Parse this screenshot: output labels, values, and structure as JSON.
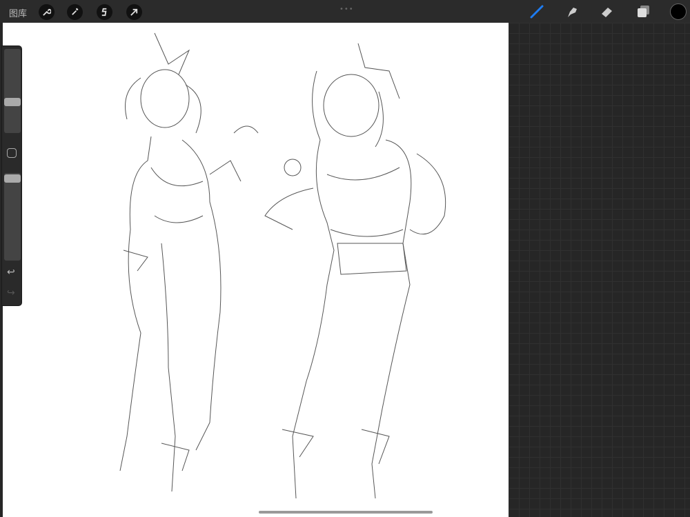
{
  "topbar": {
    "gallery_label": "图库",
    "left_tools": [
      "wrench-icon",
      "magic-wand-icon",
      "selection-icon",
      "transform-arrow-icon"
    ],
    "grip": "•••",
    "right_tools": [
      "brush-icon",
      "smudge-icon",
      "eraser-icon",
      "layers-icon"
    ],
    "active_tool": "brush",
    "accent": "#1e7cf2",
    "current_color": "#000000"
  },
  "sidebar": {
    "brush_size": 0.4,
    "opacity": 0.94,
    "undo": "↩",
    "redo": "↪"
  }
}
